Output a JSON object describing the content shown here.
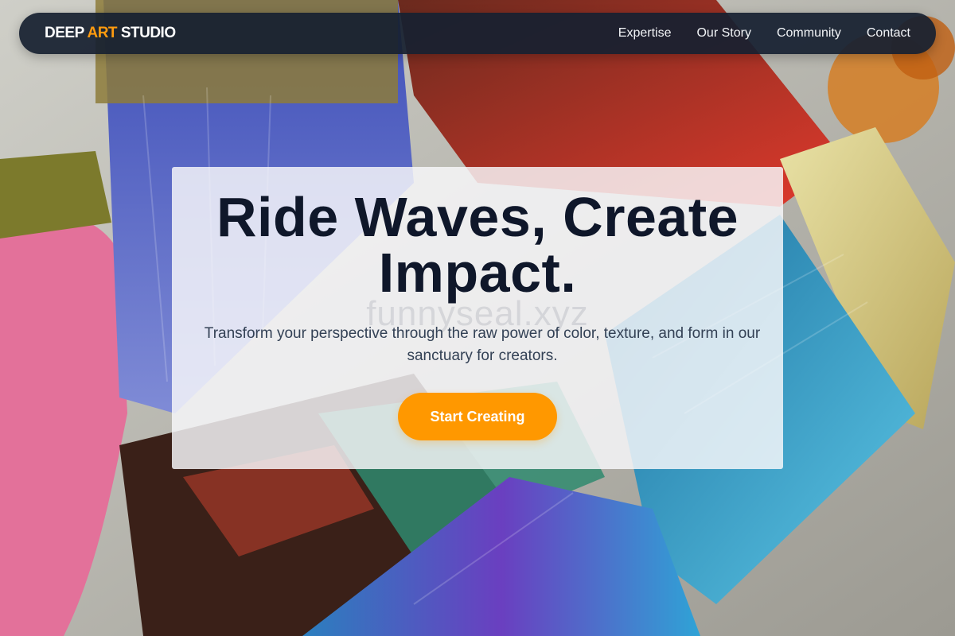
{
  "brand": {
    "part1": "DEEP ",
    "accent": "ART",
    "part2": " STUDIO",
    "accent_color": "#ff9b0f"
  },
  "nav": {
    "items": [
      {
        "label": "Expertise"
      },
      {
        "label": "Our Story"
      },
      {
        "label": "Community"
      },
      {
        "label": "Contact"
      }
    ]
  },
  "hero": {
    "headline": "Ride Waves, Create Impact.",
    "subtext": "Transform your perspective through the raw power of color, texture, and form in our sanctuary for creators.",
    "watermark": "funnyseal.xyz",
    "cta_label": "Start Creating",
    "cta_color": "#ff9800"
  },
  "background": {
    "image": "paint-brushes-photo",
    "palette": [
      "#e3719a",
      "#4a57c8",
      "#d93a2d",
      "#2f9fc7",
      "#e2d68a",
      "#8a5a2b"
    ]
  }
}
